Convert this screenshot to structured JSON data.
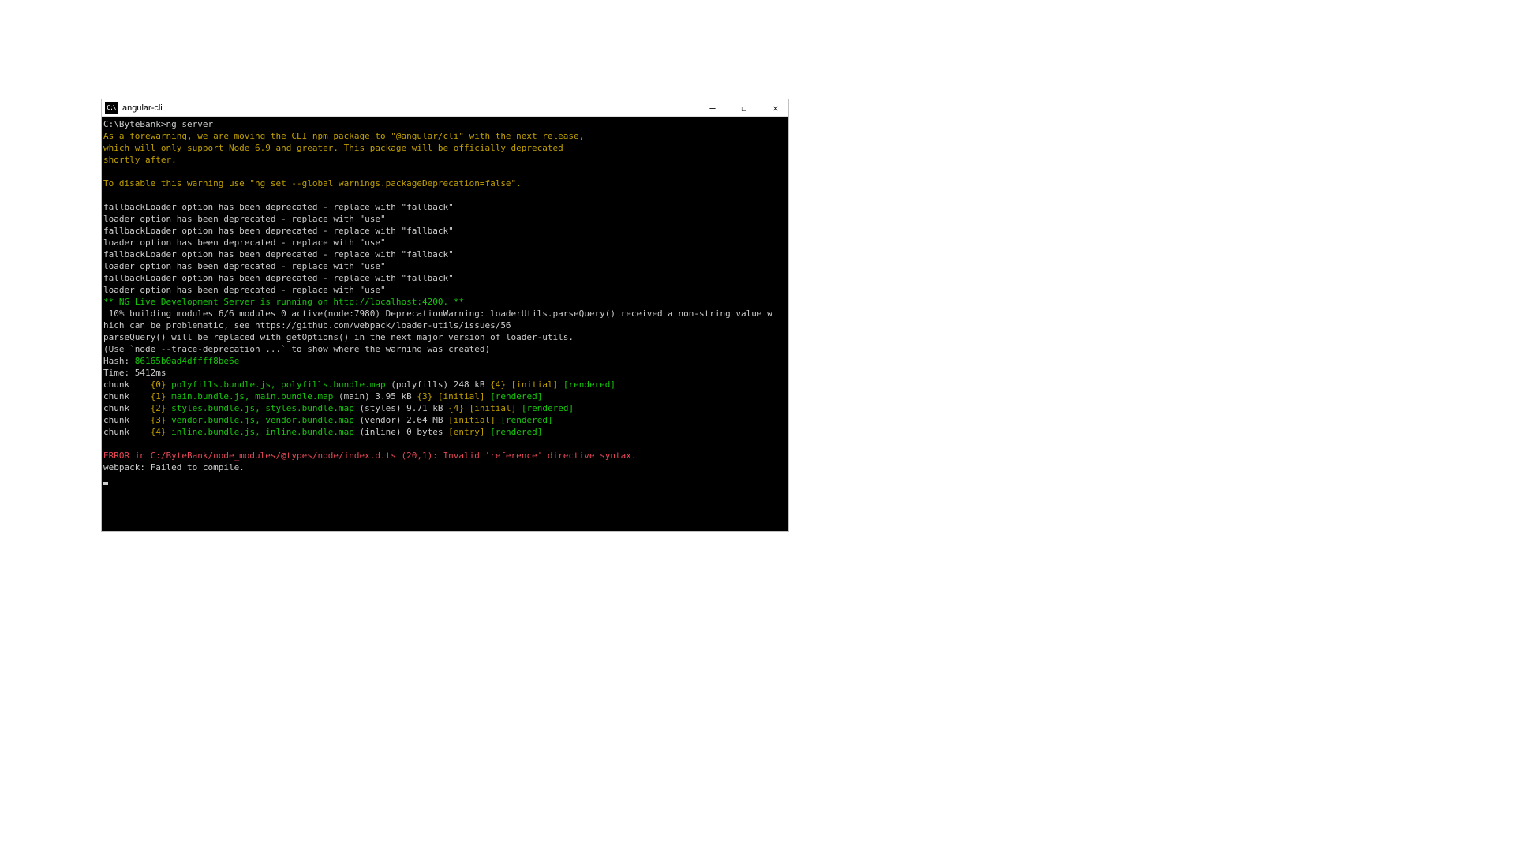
{
  "window": {
    "title": "angular-cli",
    "icon_text": "C:\\"
  },
  "terminal": {
    "prompt": "C:\\ByteBank>",
    "command": "ng server",
    "warning": {
      "l1": "As a forewarning, we are moving the CLI npm package to \"@angular/cli\" with the next release,",
      "l2": "which will only support Node 6.9 and greater. This package will be officially deprecated",
      "l3": "shortly after.",
      "l4": "To disable this warning use \"ng set --global warnings.packageDeprecation=false\"."
    },
    "deprecation": {
      "fallback": "fallbackLoader option has been deprecated - replace with \"fallback\"",
      "loader": "loader option has been deprecated - replace with \"use\""
    },
    "server_msg": "** NG Live Development Server is running on http://localhost:4200. **",
    "build": {
      "l1": " 10% building modules 6/6 modules 0 active(node:7980) DeprecationWarning: loaderUtils.parseQuery() received a non-string value w",
      "l2": "hich can be problematic, see https://github.com/webpack/loader-utils/issues/56",
      "l3": "parseQuery() will be replaced with getOptions() in the next major version of loader-utils.",
      "l4": "(Use `node --trace-deprecation ...` to show where the warning was created)"
    },
    "hash_label": "Hash: ",
    "hash": "86165b0ad4dffff8be6e",
    "time_label": "Time: ",
    "time": "5412ms",
    "chunk_label": "chunk    ",
    "chunks": [
      {
        "id": "{0}",
        "files": " polyfills.bundle.js, polyfills.bundle.map",
        "meta": " (polyfills) 248 kB ",
        "dep": "{4} ",
        "initial": "[initial]",
        "rendered": " [rendered]"
      },
      {
        "id": "{1}",
        "files": " main.bundle.js, main.bundle.map",
        "meta": " (main) 3.95 kB ",
        "dep": "{3} ",
        "initial": "[initial]",
        "rendered": " [rendered]"
      },
      {
        "id": "{2}",
        "files": " styles.bundle.js, styles.bundle.map",
        "meta": " (styles) 9.71 kB ",
        "dep": "{4} ",
        "initial": "[initial]",
        "rendered": " [rendered]"
      },
      {
        "id": "{3}",
        "files": " vendor.bundle.js, vendor.bundle.map",
        "meta": " (vendor) 2.64 MB ",
        "dep": "",
        "initial": "[initial]",
        "rendered": " [rendered]"
      },
      {
        "id": "{4}",
        "files": " inline.bundle.js, inline.bundle.map",
        "meta": " (inline) 0 bytes ",
        "dep": "",
        "initial": "[entry]",
        "rendered": " [rendered]"
      }
    ],
    "error": "ERROR in C:/ByteBank/node_modules/@types/node/index.d.ts (20,1): Invalid 'reference' directive syntax.",
    "webpack_fail": "webpack: Failed to compile."
  }
}
